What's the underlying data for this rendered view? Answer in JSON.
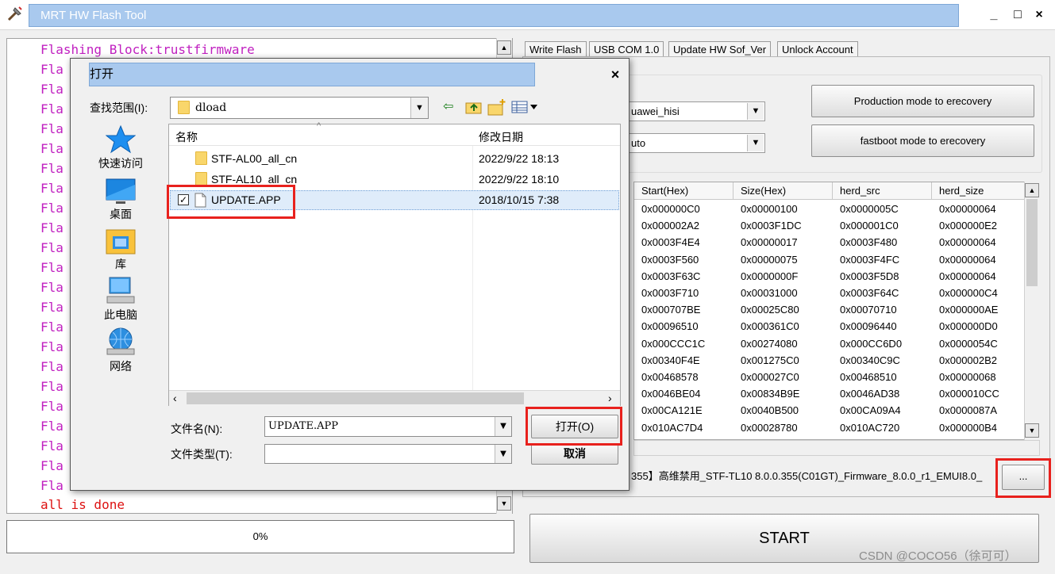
{
  "window": {
    "title": "MRT HW Flash Tool",
    "minimize": "_",
    "maximize": "□",
    "close": "×"
  },
  "log": {
    "first_line": "Flashing Block:trustfirmware",
    "line_prefix": "Fla",
    "done_line": "all is done"
  },
  "progress": {
    "label": "0%",
    "value": 0
  },
  "tabs": [
    {
      "label": "Write Flash"
    },
    {
      "label": "USB COM 1.0"
    },
    {
      "label": "Update HW Sof_Ver"
    },
    {
      "label": "Unlock Account"
    }
  ],
  "settings": {
    "combo1_value": "uawei_hisi",
    "combo2_value": "uto",
    "production_button": "Production mode to erecovery",
    "fastboot_button": "fastboot mode to erecovery"
  },
  "table": {
    "headers": [
      "Start(Hex)",
      "Size(Hex)",
      "herd_src",
      "herd_size"
    ],
    "rows": [
      [
        "0x000000C0",
        "0x00000100",
        "0x0000005C",
        "0x00000064"
      ],
      [
        "0x000002A2",
        "0x0003F1DC",
        "0x000001C0",
        "0x000000E2"
      ],
      [
        "0x0003F4E4",
        "0x00000017",
        "0x0003F480",
        "0x00000064"
      ],
      [
        "0x0003F560",
        "0x00000075",
        "0x0003F4FC",
        "0x00000064"
      ],
      [
        "0x0003F63C",
        "0x0000000F",
        "0x0003F5D8",
        "0x00000064"
      ],
      [
        "0x0003F710",
        "0x00031000",
        "0x0003F64C",
        "0x000000C4"
      ],
      [
        "0x000707BE",
        "0x00025C80",
        "0x00070710",
        "0x000000AE"
      ],
      [
        "0x00096510",
        "0x000361C0",
        "0x00096440",
        "0x000000D0"
      ],
      [
        "0x000CCC1C",
        "0x00274080",
        "0x000CC6D0",
        "0x0000054C"
      ],
      [
        "0x00340F4E",
        "0x001275C0",
        "0x00340C9C",
        "0x000002B2"
      ],
      [
        "0x00468578",
        "0x000027C0",
        "0x00468510",
        "0x00000068"
      ],
      [
        "0x0046BE04",
        "0x00834B9E",
        "0x0046AD38",
        "0x000010CC"
      ],
      [
        "0x00CA121E",
        "0x0040B500",
        "0x00CA09A4",
        "0x0000087A"
      ],
      [
        "0x010AC7D4",
        "0x00028780",
        "0x010AC720",
        "0x000000B4"
      ]
    ]
  },
  "file_path": "355】高维禁用_STF-TL10 8.0.0.355(C01GT)_Firmware_8.0.0_r1_EMUI8.0_",
  "browse_button": "...",
  "start_button": "START",
  "watermark": "CSDN @COCO56（徐可可）",
  "dialog": {
    "title": "打开",
    "close": "×",
    "look_in_label": "查找范围(I):",
    "look_in_value": "dload",
    "places": [
      {
        "label": "快速访问",
        "icon": "star-icon"
      },
      {
        "label": "桌面",
        "icon": "desktop-icon"
      },
      {
        "label": "库",
        "icon": "library-icon"
      },
      {
        "label": "此电脑",
        "icon": "computer-icon"
      },
      {
        "label": "网络",
        "icon": "network-icon"
      }
    ],
    "columns": {
      "name": "名称",
      "date": "修改日期"
    },
    "files": [
      {
        "name": "STF-AL00_all_cn",
        "date": "2022/9/22 18:13",
        "type": "folder"
      },
      {
        "name": "STF-AL10_all_cn",
        "date": "2022/9/22 18:10",
        "type": "folder"
      },
      {
        "name": "UPDATE.APP",
        "date": "2018/10/15 7:38",
        "type": "file"
      }
    ],
    "filename_label": "文件名(N):",
    "filename_value": "UPDATE.APP",
    "filetype_label": "文件类型(T):",
    "filetype_value": "",
    "open_button": "打开(O)",
    "cancel_button": "取消"
  },
  "colors": {
    "log_text": "#c020c0",
    "done_text": "#dd1111",
    "highlight_box": "#e8211d",
    "title_bar": "#a9c9ee"
  }
}
